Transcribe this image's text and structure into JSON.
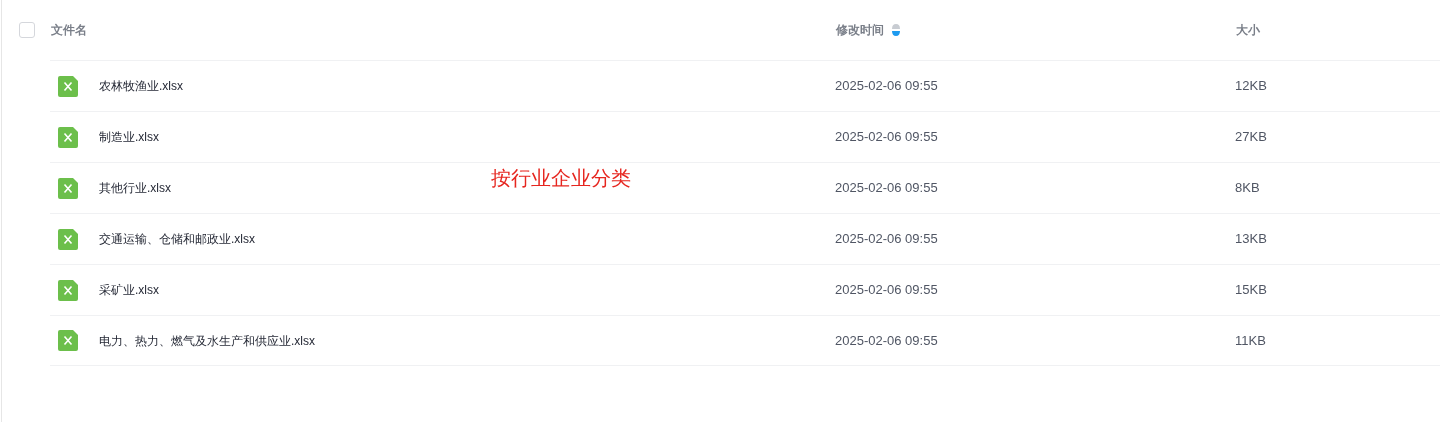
{
  "table": {
    "select_all": {
      "checked": false
    },
    "columns": [
      {
        "label": "文件名",
        "sorted": false
      },
      {
        "label": "修改时间",
        "sorted": true
      },
      {
        "label": "大小",
        "sorted": false
      }
    ],
    "rows": [
      {
        "name": "农林牧渔业.xlsx",
        "modified": "2025-02-06 09:55",
        "size": "12KB"
      },
      {
        "name": "制造业.xlsx",
        "modified": "2025-02-06 09:55",
        "size": "27KB"
      },
      {
        "name": "其他行业.xlsx",
        "modified": "2025-02-06 09:55",
        "size": "8KB"
      },
      {
        "name": "交通运输、仓储和邮政业.xlsx",
        "modified": "2025-02-06 09:55",
        "size": "13KB"
      },
      {
        "name": "采矿业.xlsx",
        "modified": "2025-02-06 09:55",
        "size": "15KB"
      },
      {
        "name": "电力、热力、燃气及水生产和供应业.xlsx",
        "modified": "2025-02-06 09:55",
        "size": "11KB"
      }
    ]
  },
  "annotation": {
    "text": "按行业企业分类"
  }
}
